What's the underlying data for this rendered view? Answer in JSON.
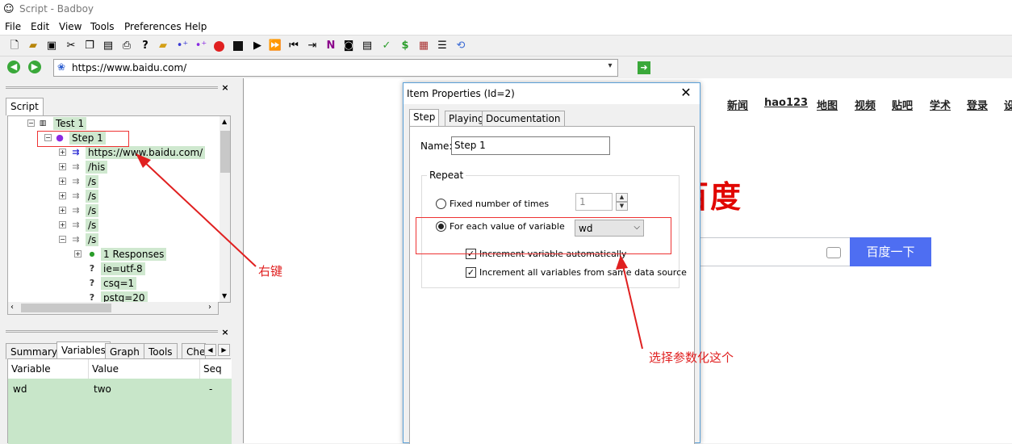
{
  "window": {
    "title": "Script - Badboy"
  },
  "menu": [
    "File",
    "Edit",
    "View",
    "Tools",
    "Preferences",
    "Help"
  ],
  "address": {
    "url": "https://www.baidu.com/"
  },
  "script_panel": {
    "tab": "Script",
    "tree": [
      {
        "label": "Test 1"
      },
      {
        "label": "Step 1"
      },
      {
        "label": "https://www.baidu.com/"
      },
      {
        "label": "/his"
      },
      {
        "label": "/s"
      },
      {
        "label": "/s"
      },
      {
        "label": "/s"
      },
      {
        "label": "/s"
      },
      {
        "label": "/s"
      },
      {
        "label": "1 Responses"
      },
      {
        "label": "ie=utf-8"
      },
      {
        "label": "csq=1"
      },
      {
        "label": "pstg=20"
      }
    ]
  },
  "bottom_panel": {
    "tabs": [
      "Summary",
      "Variables",
      "Graph",
      "Tools",
      "Che"
    ],
    "columns": [
      "Variable",
      "Value",
      "Seq"
    ],
    "rows": [
      {
        "variable": "wd",
        "value": "two",
        "seq": "-"
      }
    ]
  },
  "baidu": {
    "nav": [
      "新闻",
      "hao123",
      "地图",
      "视频",
      "贴吧",
      "学术",
      "登录",
      "设"
    ],
    "logo": "百度",
    "button": "百度一下"
  },
  "dialog": {
    "title": "Item Properties (Id=2)",
    "tabs": [
      "Step",
      "Playing",
      "Documentation"
    ],
    "name_label": "Name:",
    "name_value": "Step 1",
    "repeat_label": "Repeat",
    "fixed_label": "Fixed number of times",
    "fixed_value": "1",
    "each_label": "For each value of variable",
    "variable_value": "wd",
    "inc_auto_label": "Increment variable automatically",
    "inc_all_label": "Increment all variables from same data source"
  },
  "annotations": {
    "right_click": "右键",
    "select_param": "选择参数化这个"
  },
  "colors": {
    "annotation": "#e02020",
    "tree_highlight": "#cfe8cf",
    "baidu_red": "#e10601",
    "baidu_blue": "#4e6ef2"
  }
}
